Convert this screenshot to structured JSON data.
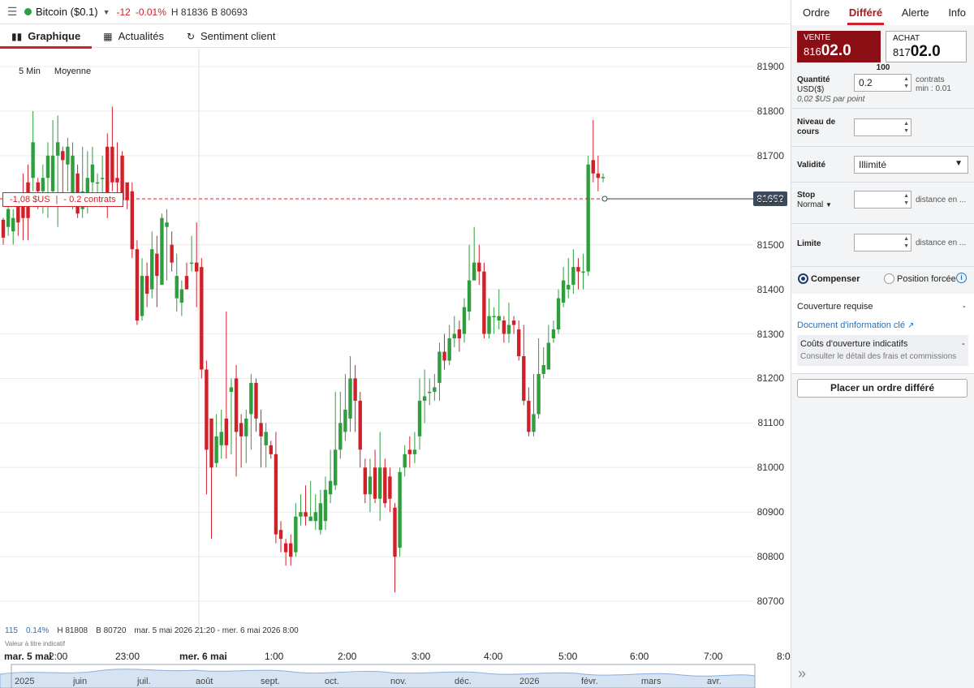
{
  "topbar": {
    "instrument": "Bitcoin ($0.1)",
    "change": "-12",
    "change_pct": "-0.01%",
    "high": "H 81836",
    "bid": "B 80693"
  },
  "tabs": [
    "Graphique",
    "Actualités",
    "Sentiment client"
  ],
  "chart": {
    "period": "5 Min",
    "indicator": "Moyenne",
    "position_pl": "-1,08 $US",
    "position_size": "- 0.2 contrats",
    "current_price": "81652",
    "yticks": [
      "81900",
      "81800",
      "81700",
      "81600",
      "81500",
      "81400",
      "81300",
      "81200",
      "81100",
      "81000",
      "80900",
      "80800",
      "80700"
    ],
    "xticks": [
      "mar. 5 mai",
      "2:00",
      "23:00",
      "mer. 6 mai",
      "1:00",
      "2:00",
      "3:00",
      "4:00",
      "5:00",
      "6:00",
      "7:00",
      "8:0"
    ],
    "stats": {
      "count": "115",
      "pct": "0.14%",
      "high": "H 81808",
      "low": "B 80720",
      "range": "mar. 5 mai 2026 21:20 - mer. 6 mai 2026 8:00"
    },
    "note": "Valeur à titre indicatif",
    "colors": {
      "up": "#2e9e3e",
      "down": "#d0202a",
      "price_tag": "#3b4a5c"
    }
  },
  "chart_data": {
    "type": "candlestick",
    "ylim": [
      80620,
      81940
    ],
    "candles": [
      [
        81556,
        81516,
        81560,
        81500
      ],
      [
        81540,
        81580,
        81601,
        81520
      ],
      [
        81530,
        81560,
        81580,
        81500
      ],
      [
        81590,
        81550,
        81610,
        81520
      ],
      [
        81610,
        81560,
        81660,
        81510
      ],
      [
        81640,
        81560,
        81680,
        81510
      ],
      [
        81650,
        81730,
        81800,
        81620
      ],
      [
        81640,
        81620,
        81650,
        81580
      ],
      [
        81620,
        81650,
        81680,
        81570
      ],
      [
        81650,
        81700,
        81730,
        81560
      ],
      [
        81620,
        81700,
        81780,
        81600
      ],
      [
        81700,
        81730,
        81790,
        81540
      ],
      [
        81710,
        81690,
        81720,
        81600
      ],
      [
        81680,
        81720,
        81740,
        81620
      ],
      [
        81610,
        81700,
        81730,
        81580
      ],
      [
        81660,
        81570,
        81680,
        81560
      ],
      [
        81580,
        81620,
        81720,
        81560
      ],
      [
        81600,
        81650,
        81710,
        81570
      ],
      [
        81640,
        81680,
        81720,
        81600
      ],
      [
        81640,
        81640,
        81660,
        81600
      ],
      [
        81650,
        81650,
        81700,
        81610
      ],
      [
        81720,
        81600,
        81750,
        81560
      ],
      [
        81720,
        81640,
        81810,
        81620
      ],
      [
        81650,
        81640,
        81730,
        81590
      ],
      [
        81700,
        81600,
        81710,
        81590
      ],
      [
        81640,
        81600,
        81620,
        81580
      ],
      [
        81620,
        81490,
        81640,
        81470
      ],
      [
        81490,
        81330,
        81510,
        81320
      ],
      [
        81340,
        81430,
        81470,
        81330
      ],
      [
        81430,
        81390,
        81460,
        81360
      ],
      [
        81400,
        81490,
        81530,
        81380
      ],
      [
        81480,
        81430,
        81520,
        81360
      ],
      [
        81410,
        81560,
        81570,
        81410
      ],
      [
        81540,
        81550,
        81580,
        81420
      ],
      [
        81500,
        81460,
        81530,
        81440
      ],
      [
        81380,
        81430,
        81480,
        81350
      ],
      [
        81370,
        81400,
        81420,
        81340
      ],
      [
        81430,
        81400,
        81460,
        81400
      ],
      [
        81460,
        81460,
        81520,
        81440
      ],
      [
        81460,
        81440,
        81550,
        81360
      ],
      [
        81450,
        81220,
        81470,
        81200
      ],
      [
        81220,
        81040,
        81240,
        80940
      ],
      [
        81110,
        81000,
        81110,
        80840
      ],
      [
        81010,
        81070,
        81120,
        81000
      ],
      [
        81050,
        81080,
        81130,
        81020
      ],
      [
        81110,
        81050,
        81350,
        81020
      ],
      [
        81170,
        81180,
        81200,
        81030
      ],
      [
        81200,
        81080,
        81230,
        80980
      ],
      [
        81100,
        81070,
        81120,
        81000
      ],
      [
        81070,
        81110,
        81130,
        81010
      ],
      [
        81120,
        81190,
        81210,
        81040
      ],
      [
        81190,
        81110,
        81200,
        81080
      ],
      [
        81100,
        81070,
        81130,
        81000
      ],
      [
        81050,
        81080,
        81100,
        81000
      ],
      [
        81050,
        81030,
        81060,
        81020
      ],
      [
        81030,
        80850,
        81080,
        80830
      ],
      [
        80860,
        80840,
        80880,
        80810
      ],
      [
        80830,
        80810,
        80840,
        80780
      ],
      [
        80830,
        80800,
        80850,
        80780
      ],
      [
        80810,
        80890,
        80920,
        80800
      ],
      [
        80890,
        80900,
        80940,
        80870
      ],
      [
        80900,
        80890,
        80960,
        80870
      ],
      [
        80880,
        80890,
        80970,
        80880
      ],
      [
        80880,
        80900,
        80940,
        80860
      ],
      [
        80860,
        80920,
        80950,
        80850
      ],
      [
        80880,
        80950,
        80980,
        80860
      ],
      [
        80940,
        80970,
        81040,
        80920
      ],
      [
        80960,
        81040,
        81170,
        80950
      ],
      [
        81040,
        81100,
        81170,
        81020
      ],
      [
        81080,
        81130,
        81210,
        81060
      ],
      [
        81110,
        81200,
        81250,
        81080
      ],
      [
        81200,
        81150,
        81230,
        81080
      ],
      [
        81150,
        81040,
        81170,
        81000
      ],
      [
        81000,
        80940,
        81020,
        80920
      ],
      [
        80940,
        80980,
        81020,
        80900
      ],
      [
        81000,
        80930,
        81040,
        80920
      ],
      [
        80930,
        81000,
        81080,
        80880
      ],
      [
        81000,
        80920,
        81020,
        80910
      ],
      [
        80980,
        80930,
        81000,
        80900
      ],
      [
        80910,
        80800,
        80920,
        80720
      ],
      [
        80820,
        80990,
        81000,
        80800
      ],
      [
        81000,
        81030,
        81050,
        80980
      ],
      [
        81040,
        81030,
        81070,
        81000
      ],
      [
        81030,
        81040,
        81080,
        81010
      ],
      [
        81070,
        81150,
        81200,
        81040
      ],
      [
        81150,
        81160,
        81220,
        81100
      ],
      [
        81170,
        81170,
        81200,
        81140
      ],
      [
        81170,
        81180,
        81210,
        81150
      ],
      [
        81190,
        81260,
        81280,
        81150
      ],
      [
        81260,
        81240,
        81300,
        81220
      ],
      [
        81240,
        81290,
        81320,
        81230
      ],
      [
        81290,
        81300,
        81340,
        81270
      ],
      [
        81310,
        81290,
        81330,
        81260
      ],
      [
        81300,
        81360,
        81380,
        81280
      ],
      [
        81350,
        81420,
        81500,
        81330
      ],
      [
        81420,
        81460,
        81540,
        81420
      ],
      [
        81460,
        81440,
        81500,
        81410
      ],
      [
        81440,
        81300,
        81460,
        81290
      ],
      [
        81300,
        81340,
        81380,
        81290
      ],
      [
        81340,
        81340,
        81360,
        81300
      ],
      [
        81330,
        81340,
        81400,
        81310
      ],
      [
        81330,
        81300,
        81340,
        81280
      ],
      [
        81300,
        81320,
        81370,
        81280
      ],
      [
        81330,
        81320,
        81340,
        81300
      ],
      [
        81310,
        81250,
        81330,
        81240
      ],
      [
        81250,
        81150,
        81320,
        81140
      ],
      [
        81150,
        81080,
        81180,
        81070
      ],
      [
        81080,
        81120,
        81210,
        81070
      ],
      [
        81120,
        81210,
        81290,
        81110
      ],
      [
        81210,
        81230,
        81270,
        81200
      ],
      [
        81220,
        81280,
        81320,
        81220
      ],
      [
        81290,
        81310,
        81330,
        81280
      ],
      [
        81310,
        81380,
        81400,
        81300
      ],
      [
        81370,
        81420,
        81450,
        81360
      ],
      [
        81400,
        81410,
        81470,
        81380
      ],
      [
        81410,
        81450,
        81490,
        81390
      ],
      [
        81450,
        81440,
        81470,
        81400
      ],
      [
        81440,
        81440,
        81480,
        81400
      ],
      [
        81440,
        81680,
        81700,
        81430
      ],
      [
        81690,
        81660,
        81780,
        81640
      ],
      [
        81660,
        81650,
        81700,
        81620
      ],
      [
        81650,
        81652,
        81660,
        81640
      ]
    ]
  },
  "navigator": {
    "labels": [
      "2025",
      "juin",
      "juil.",
      "août",
      "sept.",
      "oct.",
      "nov.",
      "déc.",
      "2026",
      "févr.",
      "mars",
      "avr."
    ]
  },
  "panel": {
    "tabs": [
      "Ordre",
      "Différé",
      "Alerte",
      "Info"
    ],
    "sell": {
      "label": "VENTE",
      "price_small": "816",
      "price_big": "02.0"
    },
    "buy": {
      "label": "ACHAT",
      "price_small": "817",
      "price_big": "02.0"
    },
    "spread": "100",
    "quantity": {
      "label": "Quantité",
      "unit": "USD($)",
      "value": "0.2",
      "side1": "contrats",
      "side2": "min : 0.01",
      "per_point": "0,02 $US par point"
    },
    "level": {
      "label1": "Niveau de",
      "label2": "cours"
    },
    "validity": {
      "label": "Validité",
      "value": "Illimité"
    },
    "stop": {
      "label": "Stop",
      "type": "Normal",
      "side": "distance en ..."
    },
    "limit": {
      "label": "Limite",
      "side": "distance en ..."
    },
    "radio1": "Compenser",
    "radio2": "Position forcée",
    "margin_label": "Couverture requise",
    "margin_value": "-",
    "doc_link": "Document d'information clé",
    "cost_label": "Coûts d'ouverture indicatifs",
    "cost_value": "-",
    "cost_link": "Consulter le détail des frais et commissions",
    "place_button": "Placer un ordre différé"
  }
}
